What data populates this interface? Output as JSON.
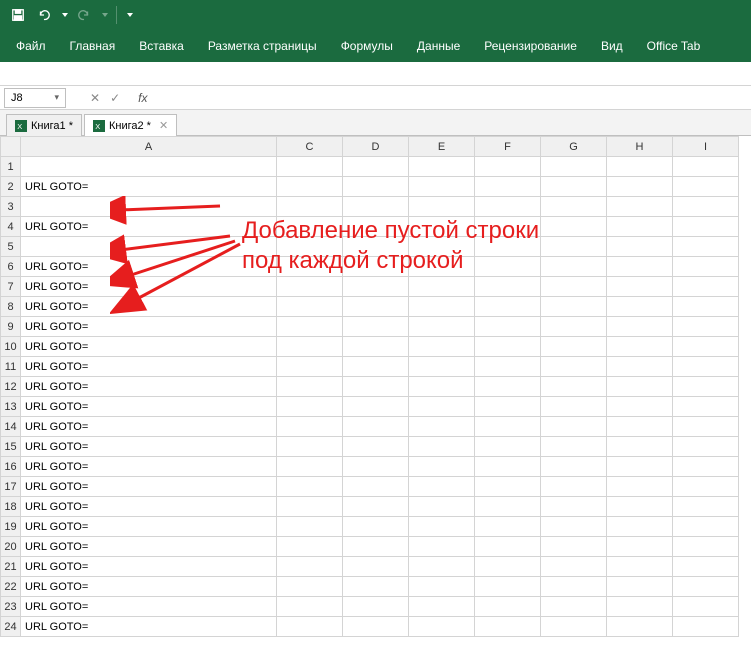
{
  "ribbon": {
    "file": "Файл",
    "home": "Главная",
    "insert": "Вставка",
    "page_layout": "Разметка страницы",
    "formulas": "Формулы",
    "data": "Данные",
    "review": "Рецензирование",
    "view": "Вид",
    "office_tab": "Office Tab"
  },
  "namebox": {
    "value": "J8",
    "fx": "fx"
  },
  "workbook_tabs": [
    {
      "label": "Книга1 *",
      "active": false
    },
    {
      "label": "Книга2 *",
      "active": true
    }
  ],
  "columns": [
    "A",
    "C",
    "D",
    "E",
    "F",
    "G",
    "H",
    "I"
  ],
  "rows": [
    {
      "n": 1,
      "a": ""
    },
    {
      "n": 2,
      "a": "URL GOTO="
    },
    {
      "n": 3,
      "a": ""
    },
    {
      "n": 4,
      "a": "URL GOTO="
    },
    {
      "n": 5,
      "a": ""
    },
    {
      "n": 6,
      "a": "URL GOTO="
    },
    {
      "n": 7,
      "a": "URL GOTO="
    },
    {
      "n": 8,
      "a": "URL GOTO="
    },
    {
      "n": 9,
      "a": "URL GOTO="
    },
    {
      "n": 10,
      "a": "URL GOTO="
    },
    {
      "n": 11,
      "a": "URL GOTO="
    },
    {
      "n": 12,
      "a": "URL GOTO="
    },
    {
      "n": 13,
      "a": "URL GOTO="
    },
    {
      "n": 14,
      "a": "URL GOTO="
    },
    {
      "n": 15,
      "a": "URL GOTO="
    },
    {
      "n": 16,
      "a": "URL GOTO="
    },
    {
      "n": 17,
      "a": "URL GOTO="
    },
    {
      "n": 18,
      "a": "URL GOTO="
    },
    {
      "n": 19,
      "a": "URL GOTO="
    },
    {
      "n": 20,
      "a": "URL GOTO="
    },
    {
      "n": 21,
      "a": "URL GOTO="
    },
    {
      "n": 22,
      "a": "URL GOTO="
    },
    {
      "n": 23,
      "a": "URL GOTO="
    },
    {
      "n": 24,
      "a": "URL GOTO="
    }
  ],
  "annotation": {
    "line1": "Добавление пустой строки",
    "line2": "под каждой строкой"
  }
}
